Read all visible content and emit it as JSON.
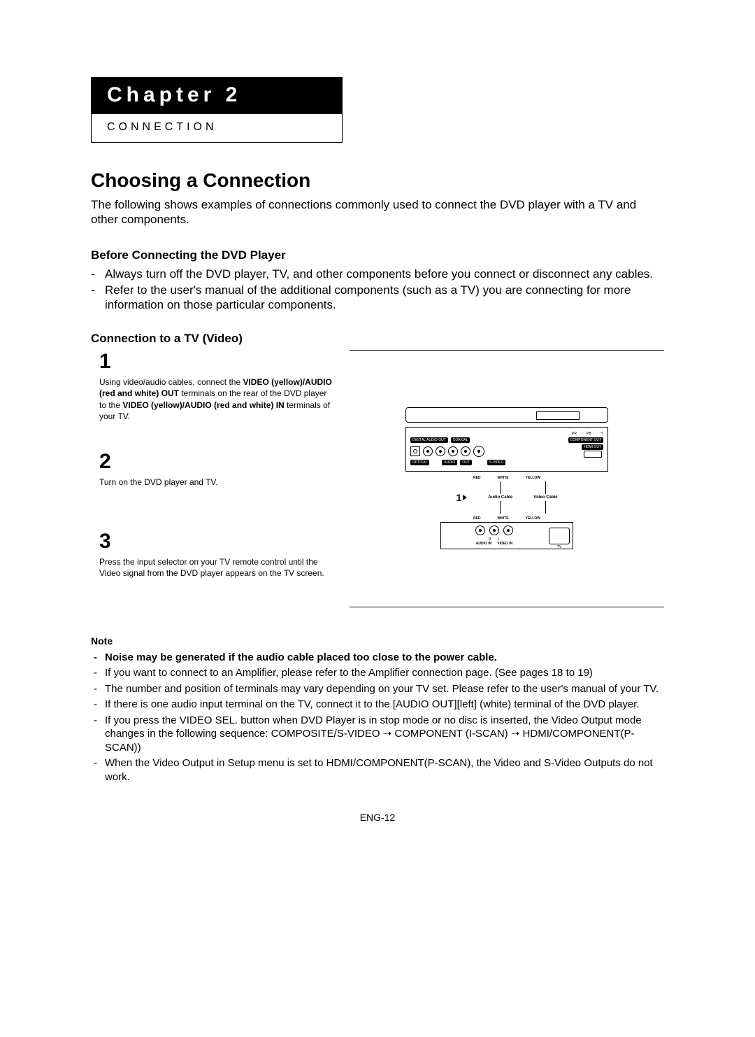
{
  "chapter": {
    "title": "Chapter 2",
    "subtitle": "CONNECTION"
  },
  "heading": "Choosing a Connection",
  "intro": "The following shows examples of connections commonly used to connect the DVD player with a TV and other components.",
  "before": {
    "title": "Before Connecting the DVD Player",
    "items": [
      "Always turn off the DVD player, TV, and other components before you connect or disconnect any cables.",
      "Refer to the user's manual of the additional components (such as a TV) you are connecting for more information on those particular components."
    ]
  },
  "tvconn": {
    "title": "Connection to a TV (Video)"
  },
  "steps": {
    "s1": {
      "num": "1",
      "t1": "Using video/audio cables, connect the ",
      "b1": "VIDEO (yellow)/AUDIO (red and white) OUT",
      "t2": " terminals on the rear of the DVD player to the ",
      "b2": "VIDEO (yellow)/AUDIO (red and white) IN",
      "t3": " terminals of your TV."
    },
    "s2": {
      "num": "2",
      "text": "Turn on the DVD player and TV."
    },
    "s3": {
      "num": "3",
      "text": "Press the input selector on your TV remote control until the Video signal from the DVD player appears on the TV screen."
    }
  },
  "diagram": {
    "labels": {
      "digital": "DIGITAL AUDIO OUT",
      "coaxial": "COAXIAL",
      "component": "COMPONENT OUT",
      "hdmi": "HDMI OUT",
      "optical": "OPTICAL",
      "audio": "AUDIO",
      "out": "OUT",
      "svideo": "S-VIDEO",
      "red": "RED",
      "white": "WHITE",
      "yellow": "YELLOW",
      "audio_cable": "Audio Cable",
      "video_cable": "Video Cable",
      "audio_in": "AUDIO IN",
      "video_in": "VIDEO IN",
      "tv": "TV",
      "r": "R",
      "l": "L",
      "pr": "PR",
      "pb": "PB",
      "y": "Y"
    },
    "step_marker": "1"
  },
  "note": {
    "title": "Note",
    "bold_item": "Noise may be generated if the audio cable placed too close to the power cable.",
    "items": [
      "If you want to connect to an Amplifier, please refer to the Amplifier connection page. (See pages 18 to 19)",
      "The number and position of terminals may vary depending on your TV set. Please refer to the user's manual of your TV.",
      "If there is one audio input terminal on the TV, connect it to the [AUDIO OUT][left] (white) terminal of the DVD player.",
      "If you press the VIDEO SEL. button when DVD Player is in stop mode or no disc is inserted, the Video Output mode changes in the following sequence: COMPOSITE/S-VIDEO ➝ COMPONENT (I-SCAN) ➝ HDMI/COMPONENT(P-SCAN))",
      "When the Video Output in Setup menu is set to HDMI/COMPONENT(P-SCAN), the Video and S-Video Outputs do not work."
    ]
  },
  "page_num": "ENG-12"
}
